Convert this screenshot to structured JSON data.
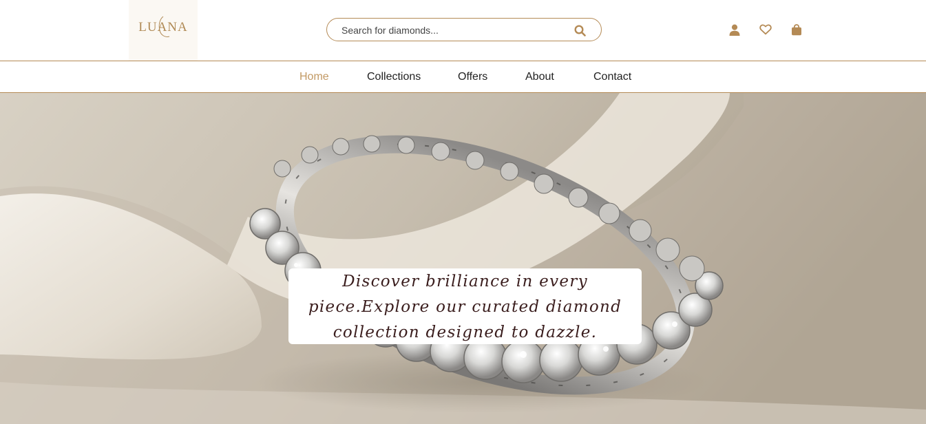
{
  "header": {
    "logo_text": "LUANA",
    "search": {
      "placeholder": "Search for diamonds...",
      "value": "",
      "icon": "search-icon"
    },
    "icons": [
      "user-icon",
      "heart-icon",
      "shopping-bag-icon"
    ]
  },
  "nav": {
    "items": [
      {
        "label": "Home",
        "active": true
      },
      {
        "label": "Collections",
        "active": false
      },
      {
        "label": "Offers",
        "active": false
      },
      {
        "label": "About",
        "active": false
      },
      {
        "label": "Contact",
        "active": false
      }
    ]
  },
  "hero": {
    "caption": "Discover brilliance in every piece.Explore our curated diamond collection designed to dazzle."
  },
  "colors": {
    "accent": "#b48a55",
    "active_nav": "#c29963",
    "caption_text": "#3a1d1d"
  }
}
